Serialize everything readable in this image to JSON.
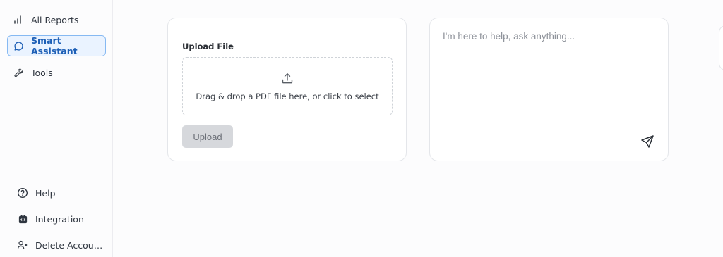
{
  "sidebar": {
    "top_items": [
      {
        "label": "All Reports",
        "icon": "bar-chart-icon"
      },
      {
        "label": "Smart Assistant",
        "icon": "chat-bubble-icon",
        "active": true
      },
      {
        "label": "Tools",
        "icon": "wrench-icon"
      }
    ],
    "bottom_items": [
      {
        "label": "Help",
        "icon": "help-circle-icon"
      },
      {
        "label": "Integration",
        "icon": "integration-icon"
      },
      {
        "label": "Delete Accou…",
        "icon": "user-remove-icon"
      }
    ]
  },
  "upload": {
    "title": "Upload File",
    "dropzone_text": "Drag & drop a PDF file here, or click to select",
    "button_label": "Upload"
  },
  "chat": {
    "placeholder": "I'm here to help, ask anything..."
  },
  "colors": {
    "accent": "#1d5fb6",
    "active_bg": "#eaf3ff",
    "active_border": "#86b9f2",
    "disabled_button": "#d6d8dc"
  }
}
